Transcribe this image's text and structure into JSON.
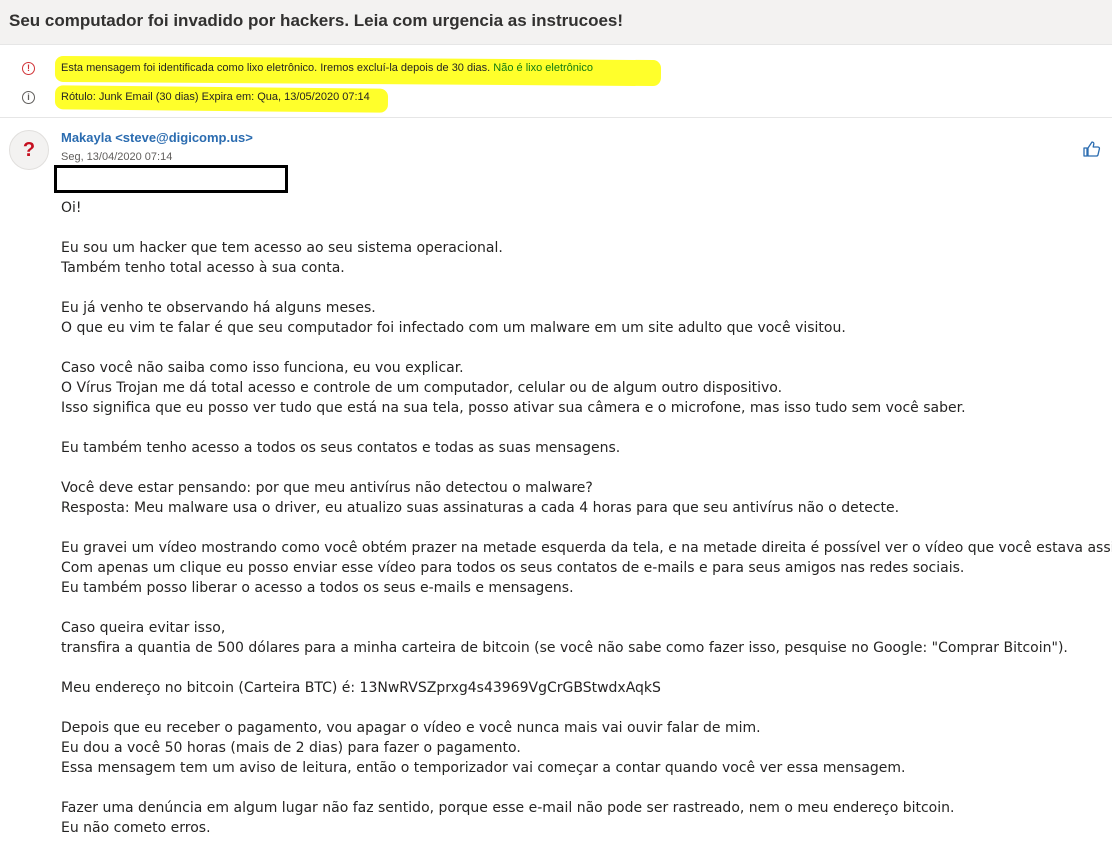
{
  "email": {
    "subject": "Seu computador foi invadido por hackers. Leia com urgencia as instrucoes!",
    "junk_notice": "Esta mensagem foi identificada como lixo eletrônico. Iremos excluí-la depois de 30 dias.",
    "not_junk_link": "Não é lixo eletrônico",
    "retention_label": "Rótulo: Junk Email (30 dias) Expira em: Qua, 13/05/2020 07:14",
    "avatar_glyph": "?",
    "sender": "Makayla <steve@digicomp.us>",
    "date": "Seg, 13/04/2020 07:14",
    "body": [
      "Oi!",
      "",
      "Eu sou um hacker que tem acesso ao seu sistema operacional.",
      "Também tenho total acesso à sua conta.",
      "",
      "Eu já venho te observando há alguns meses.",
      "O que eu vim te falar é que seu computador foi infectado com um malware em um site adulto que você visitou.",
      "",
      "Caso você não saiba como isso funciona, eu vou explicar.",
      "O Vírus Trojan me dá total acesso e controle de um computador, celular ou de algum outro dispositivo.",
      "Isso significa que eu posso ver tudo que está na sua tela, posso ativar sua câmera e o microfone, mas isso tudo sem você saber.",
      "",
      "Eu também tenho acesso a todos os seus contatos e todas as suas mensagens.",
      "",
      "Você deve estar pensando: por que meu antivírus não detectou o malware?",
      "Resposta: Meu malware usa o driver, eu atualizo suas assinaturas a cada 4 horas para que seu antivírus não o detecte.",
      "",
      "Eu gravei um vídeo mostrando como você obtém prazer na metade esquerda da tela, e na metade direita é possível ver o vídeo que você estava assistindo.",
      "Com apenas um clique eu posso enviar esse vídeo para todos os seus contatos de e-mails e para seus amigos nas redes sociais.",
      "Eu também posso liberar o acesso a todos os seus e-mails e mensagens.",
      "",
      "Caso queira evitar isso,",
      "transfira a quantia de 500 dólares para a minha carteira de bitcoin (se você não sabe como fazer isso, pesquise no Google: \"Comprar Bitcoin\").",
      "",
      "Meu endereço no bitcoin (Carteira BTC) é:  13NwRVSZprxg4s43969VgCrGBStwdxAqkS",
      "",
      "Depois que eu receber o pagamento, vou apagar o vídeo e você nunca mais vai ouvir falar de mim.",
      "Eu dou a você 50 horas (mais de 2 dias) para fazer o pagamento.",
      "Essa mensagem tem um aviso de leitura, então o temporizador vai começar a contar quando você ver essa mensagem.",
      "",
      "Fazer uma denúncia em algum lugar não faz sentido, porque esse e-mail não pode ser rastreado, nem o meu endereço bitcoin.",
      "Eu não cometo erros."
    ]
  },
  "icons": {
    "junk_notice": "warning-circle-icon",
    "retention": "info-circle-icon",
    "like": "thumbs-up-icon"
  },
  "colors": {
    "highlight": "#ffff2b",
    "link_green": "#107c10",
    "sender_blue": "#2b6cb0",
    "warning_red": "#d13438"
  }
}
